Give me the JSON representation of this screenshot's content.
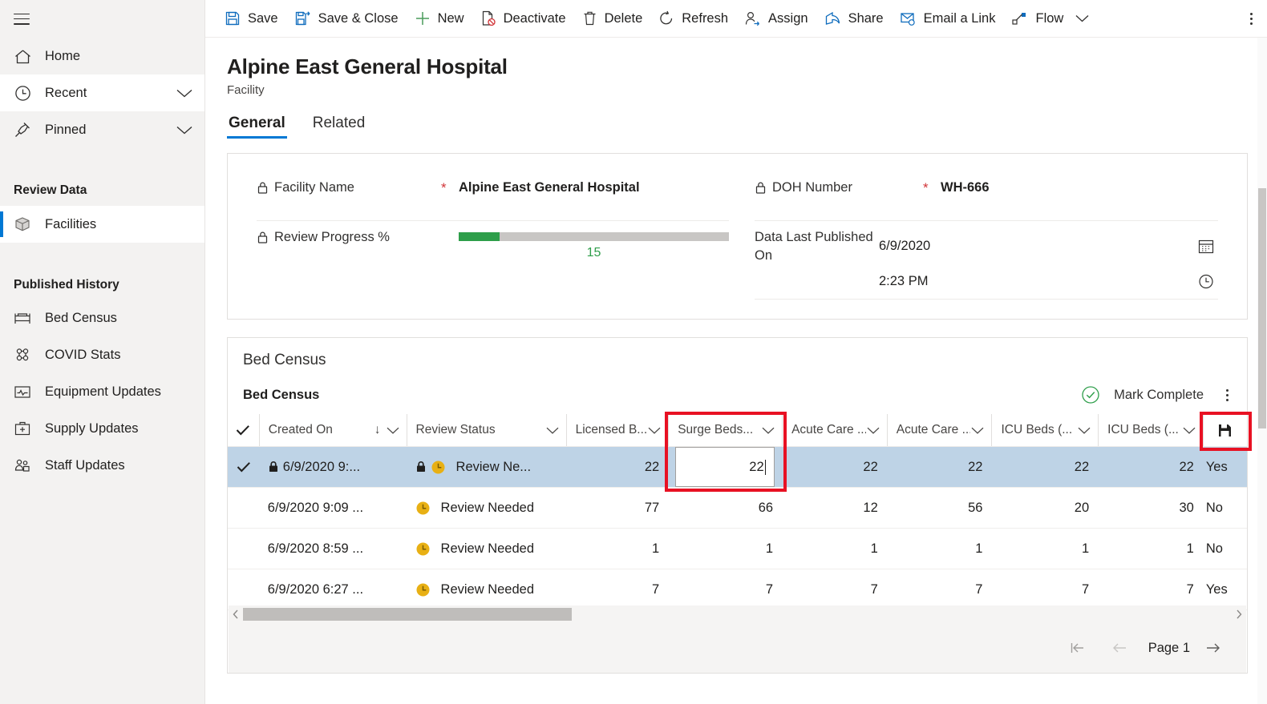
{
  "sidebar": {
    "menu_icon": "hamburger-icon",
    "items": [
      {
        "label": "Home",
        "icon": "home-icon",
        "chevron": false
      },
      {
        "label": "Recent",
        "icon": "clock-icon",
        "chevron": true
      },
      {
        "label": "Pinned",
        "icon": "pin-icon",
        "chevron": true
      }
    ],
    "groups": [
      {
        "title": "Review Data",
        "items": [
          {
            "label": "Facilities",
            "icon": "cube-icon",
            "active": true
          }
        ]
      },
      {
        "title": "Published History",
        "items": [
          {
            "label": "Bed Census",
            "icon": "bed-icon",
            "active": false
          },
          {
            "label": "COVID Stats",
            "icon": "virus-icon",
            "active": false
          },
          {
            "label": "Equipment Updates",
            "icon": "monitor-icon",
            "active": false
          },
          {
            "label": "Supply Updates",
            "icon": "medkit-icon",
            "active": false
          },
          {
            "label": "Staff Updates",
            "icon": "people-icon",
            "active": false
          }
        ]
      }
    ]
  },
  "command_bar": {
    "commands": [
      {
        "label": "Save",
        "icon": "save-icon"
      },
      {
        "label": "Save & Close",
        "icon": "save-close-icon"
      },
      {
        "label": "New",
        "icon": "plus-icon"
      },
      {
        "label": "Deactivate",
        "icon": "deactivate-icon"
      },
      {
        "label": "Delete",
        "icon": "trash-icon"
      },
      {
        "label": "Refresh",
        "icon": "refresh-icon"
      },
      {
        "label": "Assign",
        "icon": "assign-person-icon"
      },
      {
        "label": "Share",
        "icon": "share-icon"
      },
      {
        "label": "Email a Link",
        "icon": "email-link-icon"
      },
      {
        "label": "Flow",
        "icon": "flow-icon",
        "chevron": true
      }
    ],
    "overflow_icon": "overflow-vertical-dots-icon"
  },
  "record": {
    "title": "Alpine East General Hospital",
    "subtitle": "Facility"
  },
  "tabs": [
    {
      "label": "General",
      "selected": true
    },
    {
      "label": "Related",
      "selected": false
    }
  ],
  "form": {
    "facility_name": {
      "label": "Facility Name",
      "required_marker": "*",
      "value": "Alpine East General Hospital",
      "lock_icon": "lock-icon"
    },
    "review_progress": {
      "label": "Review Progress %",
      "value": "15",
      "percent": 15,
      "lock_icon": "lock-icon",
      "bar_color": "#2e9e4a",
      "track_color": "#c8c6c4"
    },
    "doh_number": {
      "label": "DOH Number",
      "required_marker": "*",
      "value": "WH-666",
      "lock_icon": "lock-icon"
    },
    "data_last_published_on": {
      "label": "Data Last Published On",
      "date_value": "6/9/2020",
      "time_value": "2:23 PM",
      "date_icon": "calendar-icon",
      "time_icon": "clock-icon"
    }
  },
  "grid_section": {
    "title": "Bed Census",
    "subtitle": "Bed Census",
    "mark_complete_label": "Mark Complete",
    "mark_complete_icon": "check-circle-icon",
    "more_icon": "overflow-vertical-dots-icon",
    "save_column_icon": "save-icon"
  },
  "grid": {
    "columns": [
      {
        "key": "check",
        "label": "",
        "icon": "checkmark-icon",
        "sort": "",
        "chevron": false
      },
      {
        "key": "created_on",
        "label": "Created On",
        "sort": "↓",
        "chevron": true
      },
      {
        "key": "review_status",
        "label": "Review Status",
        "sort": "",
        "chevron": true
      },
      {
        "key": "licensed_beds",
        "label": "Licensed B...",
        "sort": "",
        "chevron": true
      },
      {
        "key": "surge_beds",
        "label": "Surge Beds...",
        "sort": "",
        "chevron": true,
        "highlighted": true
      },
      {
        "key": "acute_care_1",
        "label": "Acute Care ...",
        "sort": "",
        "chevron": true
      },
      {
        "key": "acute_care_2",
        "label": "Acute Care ...",
        "sort": "",
        "chevron": true
      },
      {
        "key": "icu_beds_1",
        "label": "ICU Beds (...",
        "sort": "",
        "chevron": true
      },
      {
        "key": "icu_beds_2",
        "label": "ICU Beds (...",
        "sort": "",
        "chevron": true
      },
      {
        "key": "save",
        "label": "",
        "icon": "save-icon",
        "sort": "",
        "chevron": false
      }
    ],
    "rows": [
      {
        "selected": true,
        "checked": true,
        "locked": true,
        "created_on": "6/9/2020 9:...",
        "status_locked": true,
        "status_icon": "clock-yellow-icon",
        "review_status": "Review Ne...",
        "licensed_beds": "22",
        "surge_beds": "22",
        "surge_beds_editing": true,
        "acute_care_1": "22",
        "acute_care_2": "22",
        "icu_beds_1": "22",
        "icu_beds_2": "22",
        "trailing": "Yes"
      },
      {
        "selected": false,
        "checked": false,
        "locked": false,
        "created_on": "6/9/2020 9:09 ...",
        "status_locked": false,
        "status_icon": "clock-yellow-icon",
        "review_status": "Review Needed",
        "licensed_beds": "77",
        "surge_beds": "66",
        "surge_beds_editing": false,
        "acute_care_1": "12",
        "acute_care_2": "56",
        "icu_beds_1": "20",
        "icu_beds_2": "30",
        "trailing": "No"
      },
      {
        "selected": false,
        "checked": false,
        "locked": false,
        "created_on": "6/9/2020 8:59 ...",
        "status_locked": false,
        "status_icon": "clock-yellow-icon",
        "review_status": "Review Needed",
        "licensed_beds": "1",
        "surge_beds": "1",
        "surge_beds_editing": false,
        "acute_care_1": "1",
        "acute_care_2": "1",
        "icu_beds_1": "1",
        "icu_beds_2": "1",
        "trailing": "No"
      },
      {
        "selected": false,
        "checked": false,
        "locked": false,
        "created_on": "6/9/2020 6:27 ...",
        "status_locked": false,
        "status_icon": "clock-yellow-icon",
        "review_status": "Review Needed",
        "licensed_beds": "7",
        "surge_beds": "7",
        "surge_beds_editing": false,
        "acute_care_1": "7",
        "acute_care_2": "7",
        "icu_beds_1": "7",
        "icu_beds_2": "7",
        "trailing": "Yes"
      }
    ]
  },
  "pager": {
    "first_icon": "page-first-icon",
    "prev_icon": "page-prev-icon",
    "page_label": "Page 1",
    "next_icon": "page-next-icon"
  },
  "scrollbars": {
    "h_left_icon": "scroll-left-arrow-icon",
    "h_right_icon": "scroll-right-arrow-icon"
  },
  "annotations": {
    "highlight_color": "#e81123",
    "boxes": [
      "surge-beds-column-highlight",
      "grid-save-button-highlight"
    ]
  }
}
